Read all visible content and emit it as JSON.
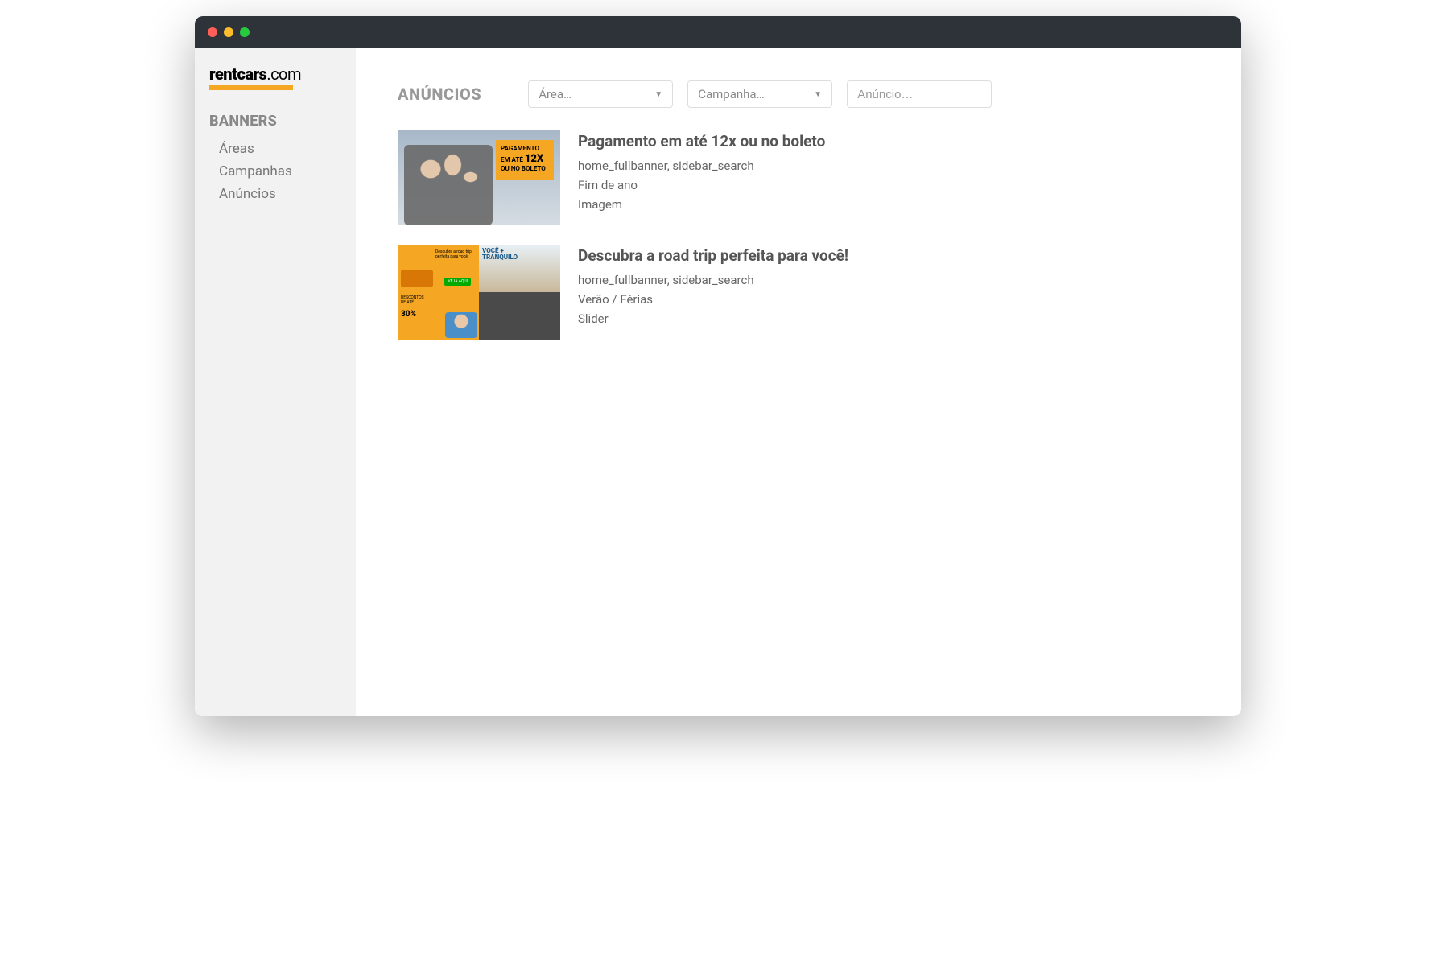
{
  "logo": {
    "brand": "rentcars",
    "suffix": ".com"
  },
  "sidebar": {
    "heading": "BANNERS",
    "items": [
      {
        "label": "Áreas"
      },
      {
        "label": "Campanhas"
      },
      {
        "label": "Anúncios"
      }
    ]
  },
  "page": {
    "title": "ANÚNCIOS"
  },
  "filters": {
    "area": {
      "placeholder": "Área…"
    },
    "campaign": {
      "placeholder": "Campanha…"
    },
    "search": {
      "placeholder": "Anúncio…"
    }
  },
  "ads": [
    {
      "title": "Pagamento em até 12x ou no boleto",
      "areas": "home_fullbanner, sidebar_search",
      "campaign": "Fim de ano",
      "type": "Imagem",
      "thumb_badge_line1": "PAGAMENTO",
      "thumb_badge_line2": "EM ATÉ",
      "thumb_badge_big": "12X",
      "thumb_badge_line3": "OU NO BOLETO"
    },
    {
      "title": "Descubra a road trip perfeita para você!",
      "areas": "home_fullbanner, sidebar_search",
      "campaign": "Verão / Férias",
      "type": "Slider",
      "thumb_q1_text": "Descubra a road trip perfeita para você!",
      "thumb_q1_btn": "VEJA AQUI",
      "thumb_q2_line1": "VOCÊ +",
      "thumb_q2_line2": "TRANQUILO",
      "thumb_q3_line1": "DESCONTOS",
      "thumb_q3_line2": "DE ATÉ",
      "thumb_q3_pct": "30%"
    }
  ]
}
